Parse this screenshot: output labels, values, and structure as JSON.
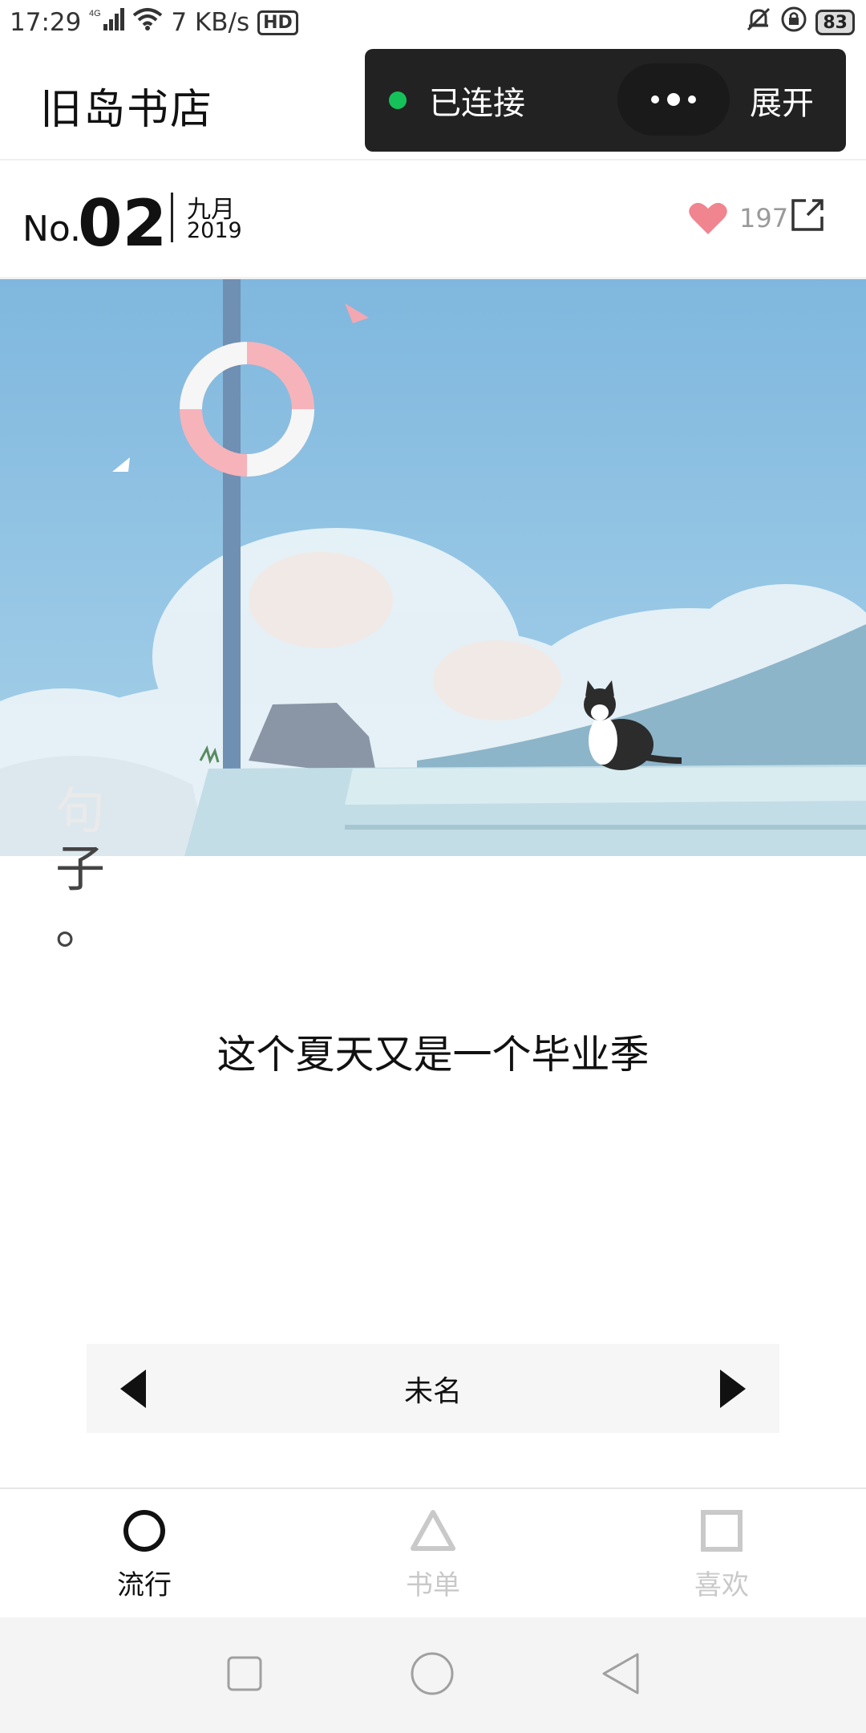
{
  "status_bar": {
    "time": "17:29",
    "network_type": "4G",
    "speed": "7 KB/s",
    "hd_label": "HD",
    "battery": "83"
  },
  "app": {
    "title": "旧岛书店"
  },
  "capsule": {
    "status": "已连接",
    "expand_label": "展开",
    "status_color": "#15c25a"
  },
  "issue": {
    "no_label": "No.",
    "no_value": "02",
    "month": "九月",
    "year": "2019",
    "like_count": "197",
    "like_color": "#f0848f"
  },
  "hero": {
    "type_chars": [
      "句",
      "子",
      "。"
    ]
  },
  "content": {
    "text": "这个夏天又是一个毕业季"
  },
  "player": {
    "title": "未名"
  },
  "tabs": [
    {
      "label": "流行",
      "icon": "circle-icon",
      "active": true
    },
    {
      "label": "书单",
      "icon": "triangle-icon",
      "active": false
    },
    {
      "label": "喜欢",
      "icon": "square-icon",
      "active": false
    }
  ],
  "nav": {
    "icons": [
      "recent-apps-icon",
      "home-icon",
      "back-icon"
    ]
  }
}
